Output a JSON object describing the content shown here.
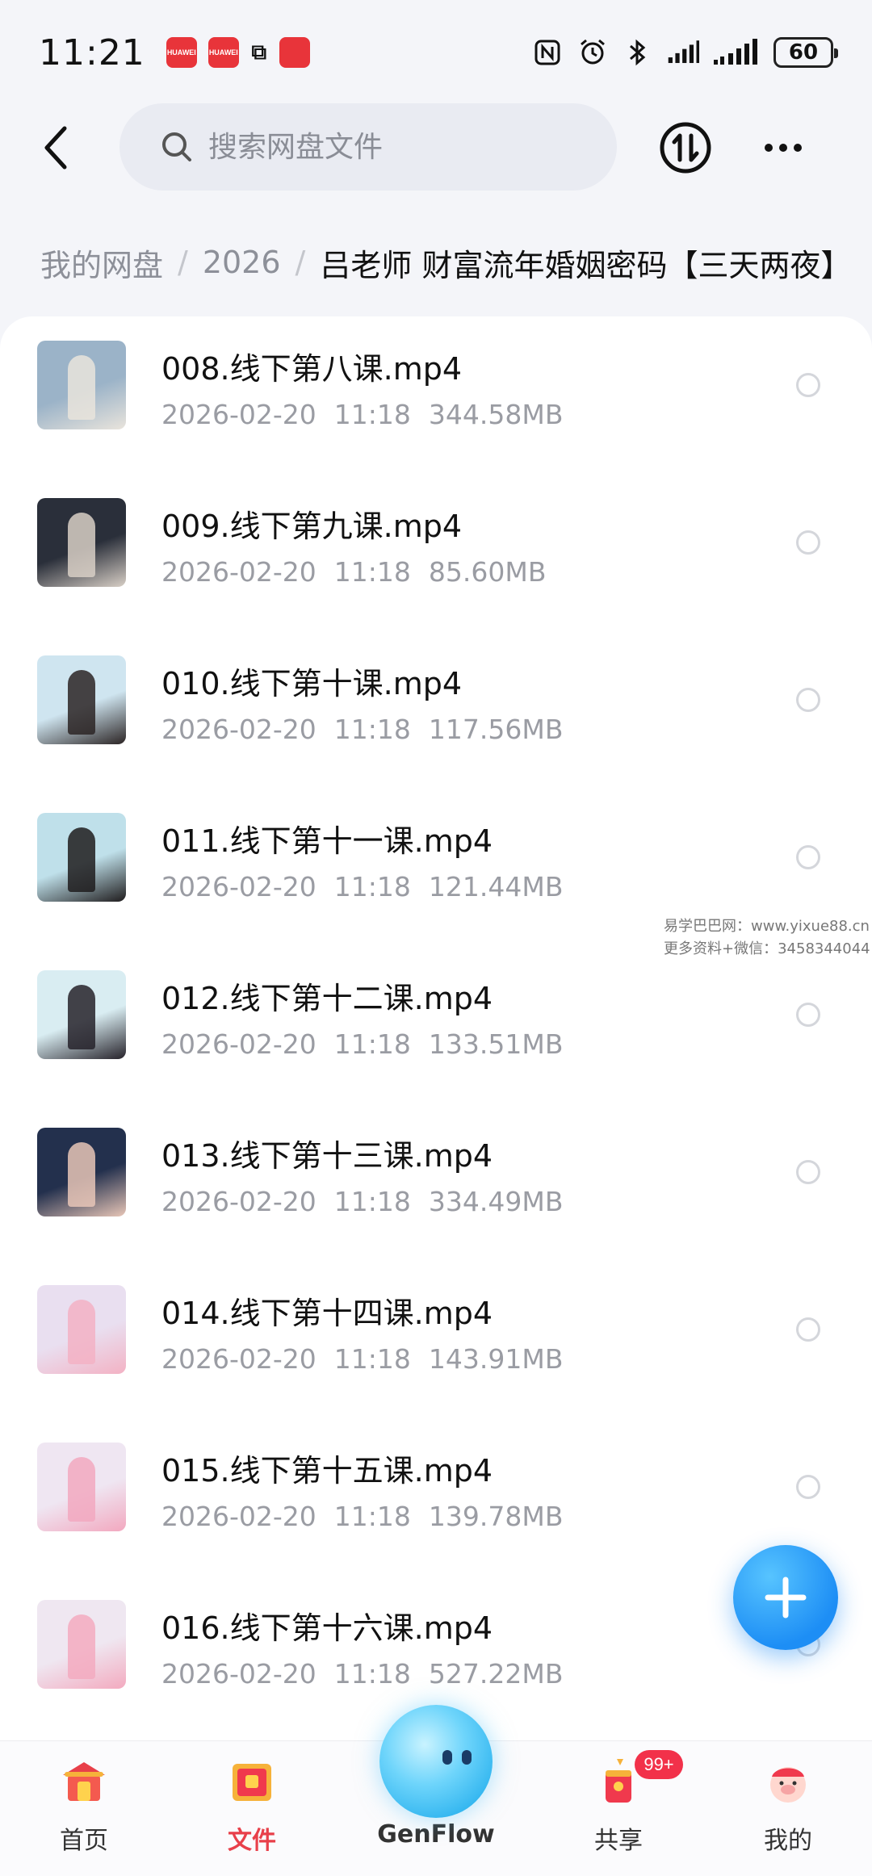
{
  "status_bar": {
    "time": "11:21",
    "app_icons": [
      "HUAWEI",
      "HUAWEI"
    ],
    "battery_level": "60"
  },
  "header": {
    "search_placeholder": "搜索网盘文件"
  },
  "breadcrumb": {
    "items": [
      "我的网盘",
      "2026"
    ],
    "current": "吕老师 财富流年婚姻密码【三天两夜】"
  },
  "files": [
    {
      "name": "008.线下第八课.mp4",
      "date": "2026-02-20",
      "time": "11:18",
      "size": "344.58MB",
      "thumb_bg": "#9bb3c8",
      "thumb_accent": "#e9e4dc"
    },
    {
      "name": "009.线下第九课.mp4",
      "date": "2026-02-20",
      "time": "11:18",
      "size": "85.60MB",
      "thumb_bg": "#2a2f3a",
      "thumb_accent": "#d8cfc6"
    },
    {
      "name": "010.线下第十课.mp4",
      "date": "2026-02-20",
      "time": "11:18",
      "size": "117.56MB",
      "thumb_bg": "#cfe5f0",
      "thumb_accent": "#2b2424"
    },
    {
      "name": "011.线下第十一课.mp4",
      "date": "2026-02-20",
      "time": "11:18",
      "size": "121.44MB",
      "thumb_bg": "#bfe0ea",
      "thumb_accent": "#1f1c1d"
    },
    {
      "name": "012.线下第十二课.mp4",
      "date": "2026-02-20",
      "time": "11:18",
      "size": "133.51MB",
      "thumb_bg": "#d9edf2",
      "thumb_accent": "#26222a"
    },
    {
      "name": "013.线下第十三课.mp4",
      "date": "2026-02-20",
      "time": "11:18",
      "size": "334.49MB",
      "thumb_bg": "#23304d",
      "thumb_accent": "#e8c6b7"
    },
    {
      "name": "014.线下第十四课.mp4",
      "date": "2026-02-20",
      "time": "11:18",
      "size": "143.91MB",
      "thumb_bg": "#e9dff0",
      "thumb_accent": "#f3b2c4"
    },
    {
      "name": "015.线下第十五课.mp4",
      "date": "2026-02-20",
      "time": "11:18",
      "size": "139.78MB",
      "thumb_bg": "#efe6f2",
      "thumb_accent": "#f2a8bf"
    },
    {
      "name": "016.线下第十六课.mp4",
      "date": "2026-02-20",
      "time": "11:18",
      "size": "527.22MB",
      "thumb_bg": "#efe7f1",
      "thumb_accent": "#f3aabf"
    }
  ],
  "watermark": {
    "line1": "易学巴巴网：www.yixue88.cn",
    "line2": "更多资料+微信：3458344044"
  },
  "bottom_nav": {
    "items": [
      {
        "label": "首页",
        "icon": "home-icon"
      },
      {
        "label": "文件",
        "icon": "file-icon"
      },
      {
        "label": "GenFlow",
        "icon": "genflow-orb-icon"
      },
      {
        "label": "共享",
        "icon": "share-icon"
      },
      {
        "label": "我的",
        "icon": "profile-icon"
      }
    ],
    "active": "文件",
    "share_badge": "99+"
  },
  "colors": {
    "accent_red": "#e8404a",
    "fab_blue": "#1d8ef5"
  }
}
